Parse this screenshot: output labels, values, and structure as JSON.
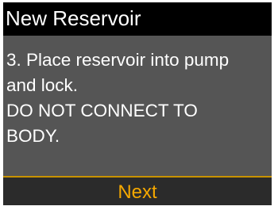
{
  "screen": {
    "title": "New Reservoir",
    "lines": [
      "3. Place reservoir into pump",
      "and lock.",
      "DO NOT CONNECT TO",
      "BODY."
    ]
  },
  "softkey": {
    "label": "Next"
  },
  "colors": {
    "title_bar": "#000000",
    "background": "#555555",
    "softkey_bar": "#2b2b2b",
    "softkey_text": "#f5a800",
    "divider": "#c89200",
    "text": "#ffffff"
  }
}
